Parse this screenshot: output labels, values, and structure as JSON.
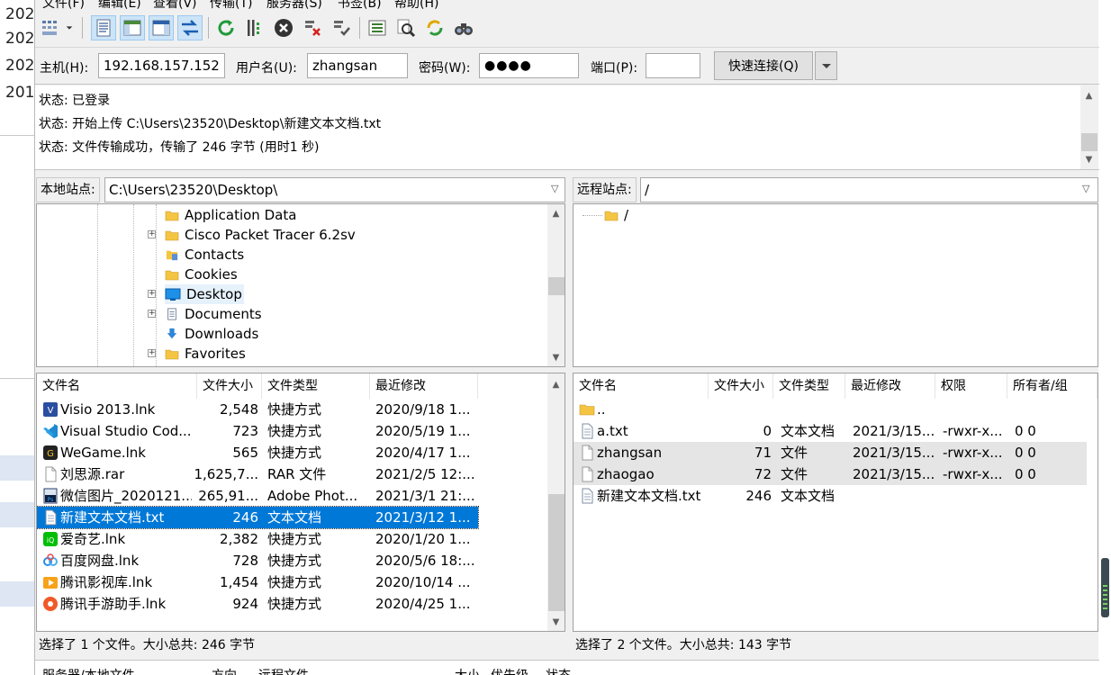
{
  "background_window": {
    "years": [
      "202",
      "202",
      "202",
      "201"
    ]
  },
  "menu": [
    "文件(F)",
    "编辑(E)",
    "查看(V)",
    "传输(T)",
    "服务器(S)",
    "书签(B)",
    "帮助(H)"
  ],
  "quickconnect": {
    "host_label": "主机(H):",
    "host_value": "192.168.157.152",
    "user_label": "用户名(U):",
    "user_value": "zhangsan",
    "pass_label": "密码(W):",
    "pass_value": "●●●●",
    "port_label": "端口(P):",
    "port_value": "",
    "connect_button": "快速连接(Q)"
  },
  "log": [
    "状态:  已登录",
    "状态:  开始上传 C:\\Users\\23520\\Desktop\\新建文本文档.txt",
    "状态:  文件传输成功，传输了 246 字节 (用时1 秒)"
  ],
  "local_site": {
    "label": "本地站点:",
    "path": "C:\\Users\\23520\\Desktop\\"
  },
  "remote_site": {
    "label": "远程站点:",
    "path": "/"
  },
  "local_tree": [
    {
      "name": "Application Data",
      "expandable": false
    },
    {
      "name": "Cisco Packet Tracer 6.2sv",
      "expandable": true
    },
    {
      "name": "Contacts",
      "expandable": false
    },
    {
      "name": "Cookies",
      "expandable": false
    },
    {
      "name": "Desktop",
      "expandable": true
    },
    {
      "name": "Documents",
      "expandable": true
    },
    {
      "name": "Downloads",
      "expandable": false
    },
    {
      "name": "Favorites",
      "expandable": true
    }
  ],
  "remote_tree": [
    {
      "name": "/"
    }
  ],
  "local_columns": [
    "文件名",
    "文件大小",
    "文件类型",
    "最近修改"
  ],
  "local_files": [
    {
      "name": "Visio 2013.lnk",
      "size": "2,548",
      "type": "快捷方式",
      "modified": "2020/9/18 1...",
      "icon": "visio-icon",
      "selected": false
    },
    {
      "name": "Visual Studio Cod...",
      "size": "723",
      "type": "快捷方式",
      "modified": "2020/5/19 1...",
      "icon": "vscode-icon",
      "selected": false
    },
    {
      "name": "WeGame.lnk",
      "size": "565",
      "type": "快捷方式",
      "modified": "2020/4/17 1...",
      "icon": "wegame-icon",
      "selected": false
    },
    {
      "name": "刘思源.rar",
      "size": "1,625,7...",
      "type": "RAR 文件",
      "modified": "2021/2/5 12:...",
      "icon": "file-icon",
      "selected": false
    },
    {
      "name": "微信图片_2020121...",
      "size": "265,91...",
      "type": "Adobe Phot...",
      "modified": "2021/3/1 21:...",
      "icon": "photoshop-icon",
      "selected": false
    },
    {
      "name": "新建文本文档.txt",
      "size": "246",
      "type": "文本文档",
      "modified": "2021/3/12 1...",
      "icon": "text-file-icon",
      "selected": true
    },
    {
      "name": "爱奇艺.lnk",
      "size": "2,382",
      "type": "快捷方式",
      "modified": "2020/1/20 1...",
      "icon": "iqiyi-icon",
      "selected": false
    },
    {
      "name": "百度网盘.lnk",
      "size": "728",
      "type": "快捷方式",
      "modified": "2020/5/6 18:...",
      "icon": "baidu-netdisk-icon",
      "selected": false
    },
    {
      "name": "腾讯影视库.lnk",
      "size": "1,454",
      "type": "快捷方式",
      "modified": "2020/10/14 ...",
      "icon": "tencent-video-icon",
      "selected": false
    },
    {
      "name": "腾讯手游助手.lnk",
      "size": "924",
      "type": "快捷方式",
      "modified": "2020/4/25 1...",
      "icon": "tencent-game-icon",
      "selected": false
    }
  ],
  "remote_columns": [
    "文件名",
    "文件大小",
    "文件类型",
    "最近修改",
    "权限",
    "所有者/组"
  ],
  "remote_files": [
    {
      "name": "..",
      "size": "",
      "type": "",
      "modified": "",
      "perm": "",
      "owner": "",
      "icon": "folder-icon",
      "selected": false
    },
    {
      "name": "a.txt",
      "size": "0",
      "type": "文本文档",
      "modified": "2021/3/15...",
      "perm": "-rwxr-x...",
      "owner": "0 0",
      "icon": "text-file-icon",
      "selected": false
    },
    {
      "name": "zhangsan",
      "size": "71",
      "type": "文件",
      "modified": "2021/3/15...",
      "perm": "-rwxr-x...",
      "owner": "0 0",
      "icon": "file-icon",
      "selected": true
    },
    {
      "name": "zhaogao",
      "size": "72",
      "type": "文件",
      "modified": "2021/3/15...",
      "perm": "-rwxr-x...",
      "owner": "0 0",
      "icon": "file-icon",
      "selected": true
    },
    {
      "name": "新建文本文档.txt",
      "size": "246",
      "type": "文本文档",
      "modified": "",
      "perm": "",
      "owner": "",
      "icon": "text-file-icon",
      "selected": false
    }
  ],
  "local_status": "选择了 1 个文件。大小总共: 246 字节",
  "remote_status": "选择了 2 个文件。大小总共: 143 字节",
  "queue_columns": [
    "服务器/本地文件",
    "方向",
    "远程文件",
    "大小",
    "优先级",
    "状态"
  ],
  "colors": {
    "selection": "#0078d7",
    "selection_light": "#e5e5e5",
    "folder": "#f4c542"
  }
}
